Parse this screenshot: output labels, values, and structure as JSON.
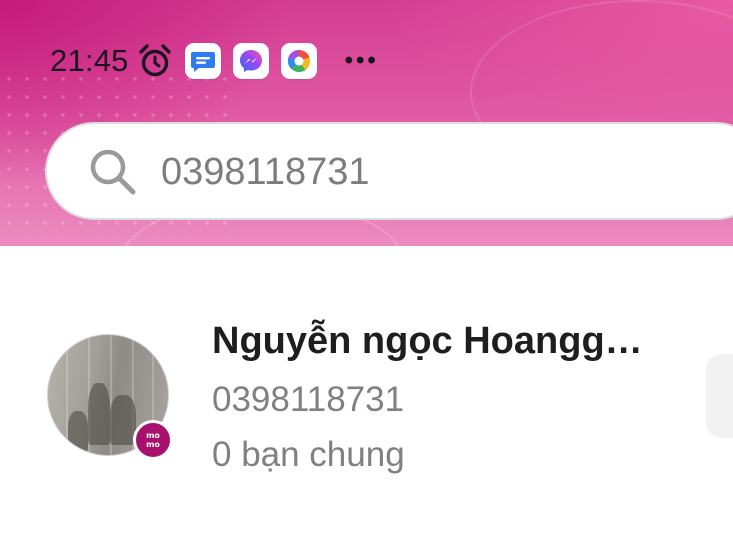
{
  "status_bar": {
    "time": "21:45",
    "icons": [
      "alarm-icon",
      "messages-icon",
      "messenger-icon",
      "photo-app-icon"
    ],
    "more": "•••"
  },
  "search": {
    "value": "0398118731",
    "placeholder": "",
    "icon": "search-icon"
  },
  "results": [
    {
      "name": "Nguyễn ngọc Hoangg…",
      "phone": "0398118731",
      "mutual": "0 bạn chung",
      "badge": "momo",
      "badge_lines": [
        "mo",
        "mo"
      ]
    }
  ],
  "colors": {
    "header_primary": "#d43d91",
    "header_light": "#ec8cc0",
    "badge": "#a8106b",
    "text_primary": "#1e1e1e",
    "text_secondary": "#808080"
  }
}
